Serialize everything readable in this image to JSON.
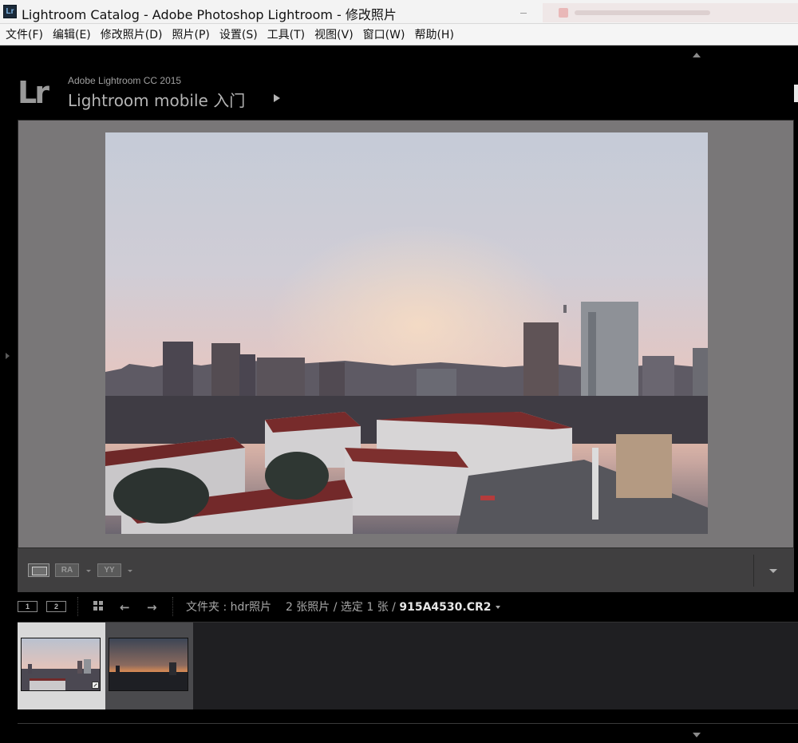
{
  "window": {
    "title": "Lightroom Catalog - Adobe Photoshop Lightroom - 修改照片",
    "app_icon_label": "Lr"
  },
  "menu": {
    "items": [
      "文件(F)",
      "编辑(E)",
      "修改照片(D)",
      "照片(P)",
      "设置(S)",
      "工具(T)",
      "视图(V)",
      "窗口(W)",
      "帮助(H)"
    ]
  },
  "identity": {
    "logo": "Lr",
    "product": "Adobe Lightroom CC 2015",
    "plate": "Lightroom mobile 入门"
  },
  "toolbar": {
    "compare_label": "RA",
    "survey_label": "YY"
  },
  "filmstrip_header": {
    "monitor1": "1",
    "monitor2": "2",
    "folder_prefix": "文件夹 : hdr照片",
    "count_text": "2 张照片 / 选定 1 张 /",
    "filename": "915A4530.CR2"
  },
  "filmstrip": {
    "selected_index": 0,
    "count": 2
  },
  "colors": {
    "accent_bg": "#000000",
    "view_gray": "#797778",
    "selected_cell": "#d9d9d9"
  }
}
